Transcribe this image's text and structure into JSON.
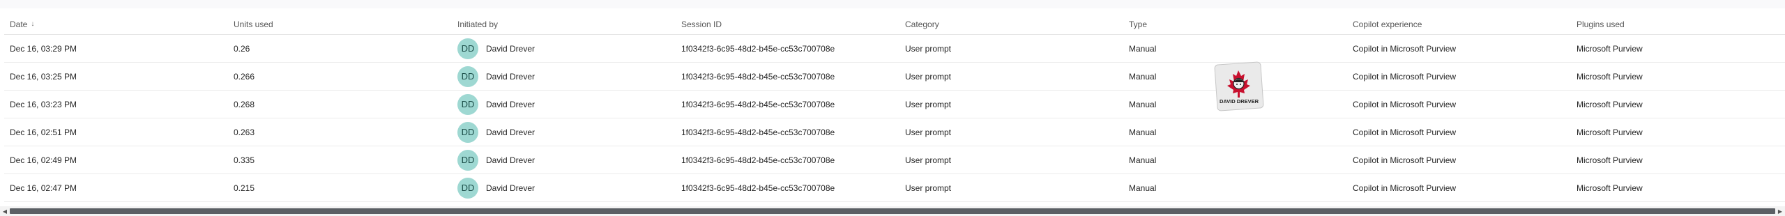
{
  "table": {
    "columns": [
      "Date",
      "Units used",
      "Initiated by",
      "Session ID",
      "Category",
      "Type",
      "Copilot experience",
      "Plugins used"
    ],
    "sort_indicator": "↓",
    "rows": [
      {
        "date": "Dec 16, 03:29 PM",
        "units": "0.26",
        "initials": "DD",
        "user": "David Drever",
        "session": "1f0342f3-6c95-48d2-b45e-cc53c700708e",
        "category": "User prompt",
        "type": "Manual",
        "experience": "Copilot in Microsoft Purview",
        "plugins": "Microsoft Purview"
      },
      {
        "date": "Dec 16, 03:25 PM",
        "units": "0.266",
        "initials": "DD",
        "user": "David Drever",
        "session": "1f0342f3-6c95-48d2-b45e-cc53c700708e",
        "category": "User prompt",
        "type": "Manual",
        "experience": "Copilot in Microsoft Purview",
        "plugins": "Microsoft Purview"
      },
      {
        "date": "Dec 16, 03:23 PM",
        "units": "0.268",
        "initials": "DD",
        "user": "David Drever",
        "session": "1f0342f3-6c95-48d2-b45e-cc53c700708e",
        "category": "User prompt",
        "type": "Manual",
        "experience": "Copilot in Microsoft Purview",
        "plugins": "Microsoft Purview"
      },
      {
        "date": "Dec 16, 02:51 PM",
        "units": "0.263",
        "initials": "DD",
        "user": "David Drever",
        "session": "1f0342f3-6c95-48d2-b45e-cc53c700708e",
        "category": "User prompt",
        "type": "Manual",
        "experience": "Copilot in Microsoft Purview",
        "plugins": "Microsoft Purview"
      },
      {
        "date": "Dec 16, 02:49 PM",
        "units": "0.335",
        "initials": "DD",
        "user": "David Drever",
        "session": "1f0342f3-6c95-48d2-b45e-cc53c700708e",
        "category": "User prompt",
        "type": "Manual",
        "experience": "Copilot in Microsoft Purview",
        "plugins": "Microsoft Purview"
      },
      {
        "date": "Dec 16, 02:47 PM",
        "units": "0.215",
        "initials": "DD",
        "user": "David Drever",
        "session": "1f0342f3-6c95-48d2-b45e-cc53c700708e",
        "category": "User prompt",
        "type": "Manual",
        "experience": "Copilot in Microsoft Purview",
        "plugins": "Microsoft Purview"
      }
    ]
  },
  "watermark": {
    "text": "DAVID DREVER",
    "accent": "#c8102e"
  },
  "colors": {
    "avatar_bg": "#9ed8d2",
    "scroll_thumb": "#5b5f64"
  },
  "scrollbar": {
    "left_icon": "◀",
    "right_icon": "▶"
  }
}
